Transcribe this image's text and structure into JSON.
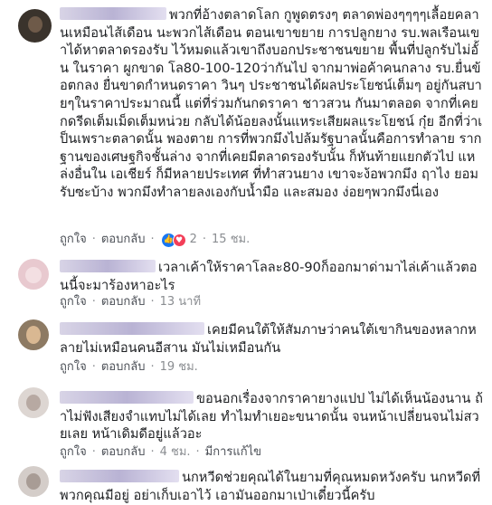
{
  "comments": [
    {
      "text": "พวกที่อ้างตลาดโลก กูพูดตรงๆ ตลาดพ่องๆๆๆๆเลื้อยคลานเหมือนไส้เดือน นะพวกไส้เดือน ตอนเขาขยาย การปลูกยาง รบ.พลเรือนเขาได้หาตลาดรองรับ ไว้หมดแล้วเขาถึงบอกประชาชนขยาย พื้นที่ปลูกรับไม่อั้น ในราคา ผูกขาด โล80-100-120ว่ากันไป จากมาพ่อค้าคนกลาง รบ.ยื่นข้อตกลง ยื่นขาดกำหนดราคา วินๆ ประชาชนได้ผลประโยชน์เต็มๆ อยู่กันสบายๆในราคาประมาณนี้ แต่ที่ร่วมกันกดราคา ชาวสวน กันมาตลอด จากที่เคยกดรีดเต็มเม็ดเต็มหน่วย กลับได้น้อยลงนั้นแหระเสียผลแระโยชน์ กุ๋ย อีกที่ว่าเป็นเพราะตลาดนั้น พองตาย การที่พวกมึงไปล้มรัฐบาลนั้นคือการทำลาย รากฐานของเศษฐกิจชั้นล่าง จากที่เคยมีตลาดรองรับนั้น ก็หันท้ายแยกตัวไป แหล่งอื่นใน เอเชียร์ ก็มีหลายประเทศ ที่ทำสวนยาง เขาจะง้อพวกมึง ฤาไง ยอมรับซะบ้าง พวกมึงทำลายลงเองกับน้ำมือ และสมอง ง่อยๆพวกมึงนี่เอง",
      "like": "ถูกใจ",
      "reply": "ตอบกลับ",
      "reactions": "2",
      "time": "15 ชม."
    },
    {
      "text": "เวลาเค้าให้ราคาโลละ80-90ก็ออกมาด่ามาไล่เค้าแล้วตอนนี้จะมาร้องหาอะไร",
      "like": "ถูกใจ",
      "reply": "ตอบกลับ",
      "time": "13 นาที"
    },
    {
      "text": "เคยมีคนใต้ให้สัมภาษว่าคนใต้เขากินของหลากหลายไม่เหมือนคนอีสาน มันไม่เหมือนกัน",
      "like": "ถูกใจ",
      "reply": "ตอบกลับ",
      "time": "19 ชม."
    },
    {
      "text": "ขอนอกเรื่องจากราคายางแปป ไม่ได้เห็นน้องนาน ถ้าไม่ฟังเสียงจำแทบไม่ได้เลย ทำไมทำเยอะขนาดนั้น จนหน้าเปลี่ยนจนไม่สวยเลย หน้าเดิมดีอยู่แล้วอะ",
      "like": "ถูกใจ",
      "reply": "ตอบกลับ",
      "time": "4 ชม.",
      "edited": "มีการแก้ไข"
    },
    {
      "text": "นกหวีดช่วยคุณได้ในยามที่คุณหมดหวังครับ นกหวีดที่พวกคุณมีอยู่ อย่าเก็บเอาไว้ เอามันออกมาเป่าเดี๋ยวนี้ครับ"
    }
  ],
  "colors": {
    "meta": "#8a8d91",
    "link": "#4b4f56",
    "like": "#1877f2",
    "love": "#f33e58"
  },
  "icons": {
    "like": "thumbs-up-icon",
    "love": "heart-icon"
  }
}
